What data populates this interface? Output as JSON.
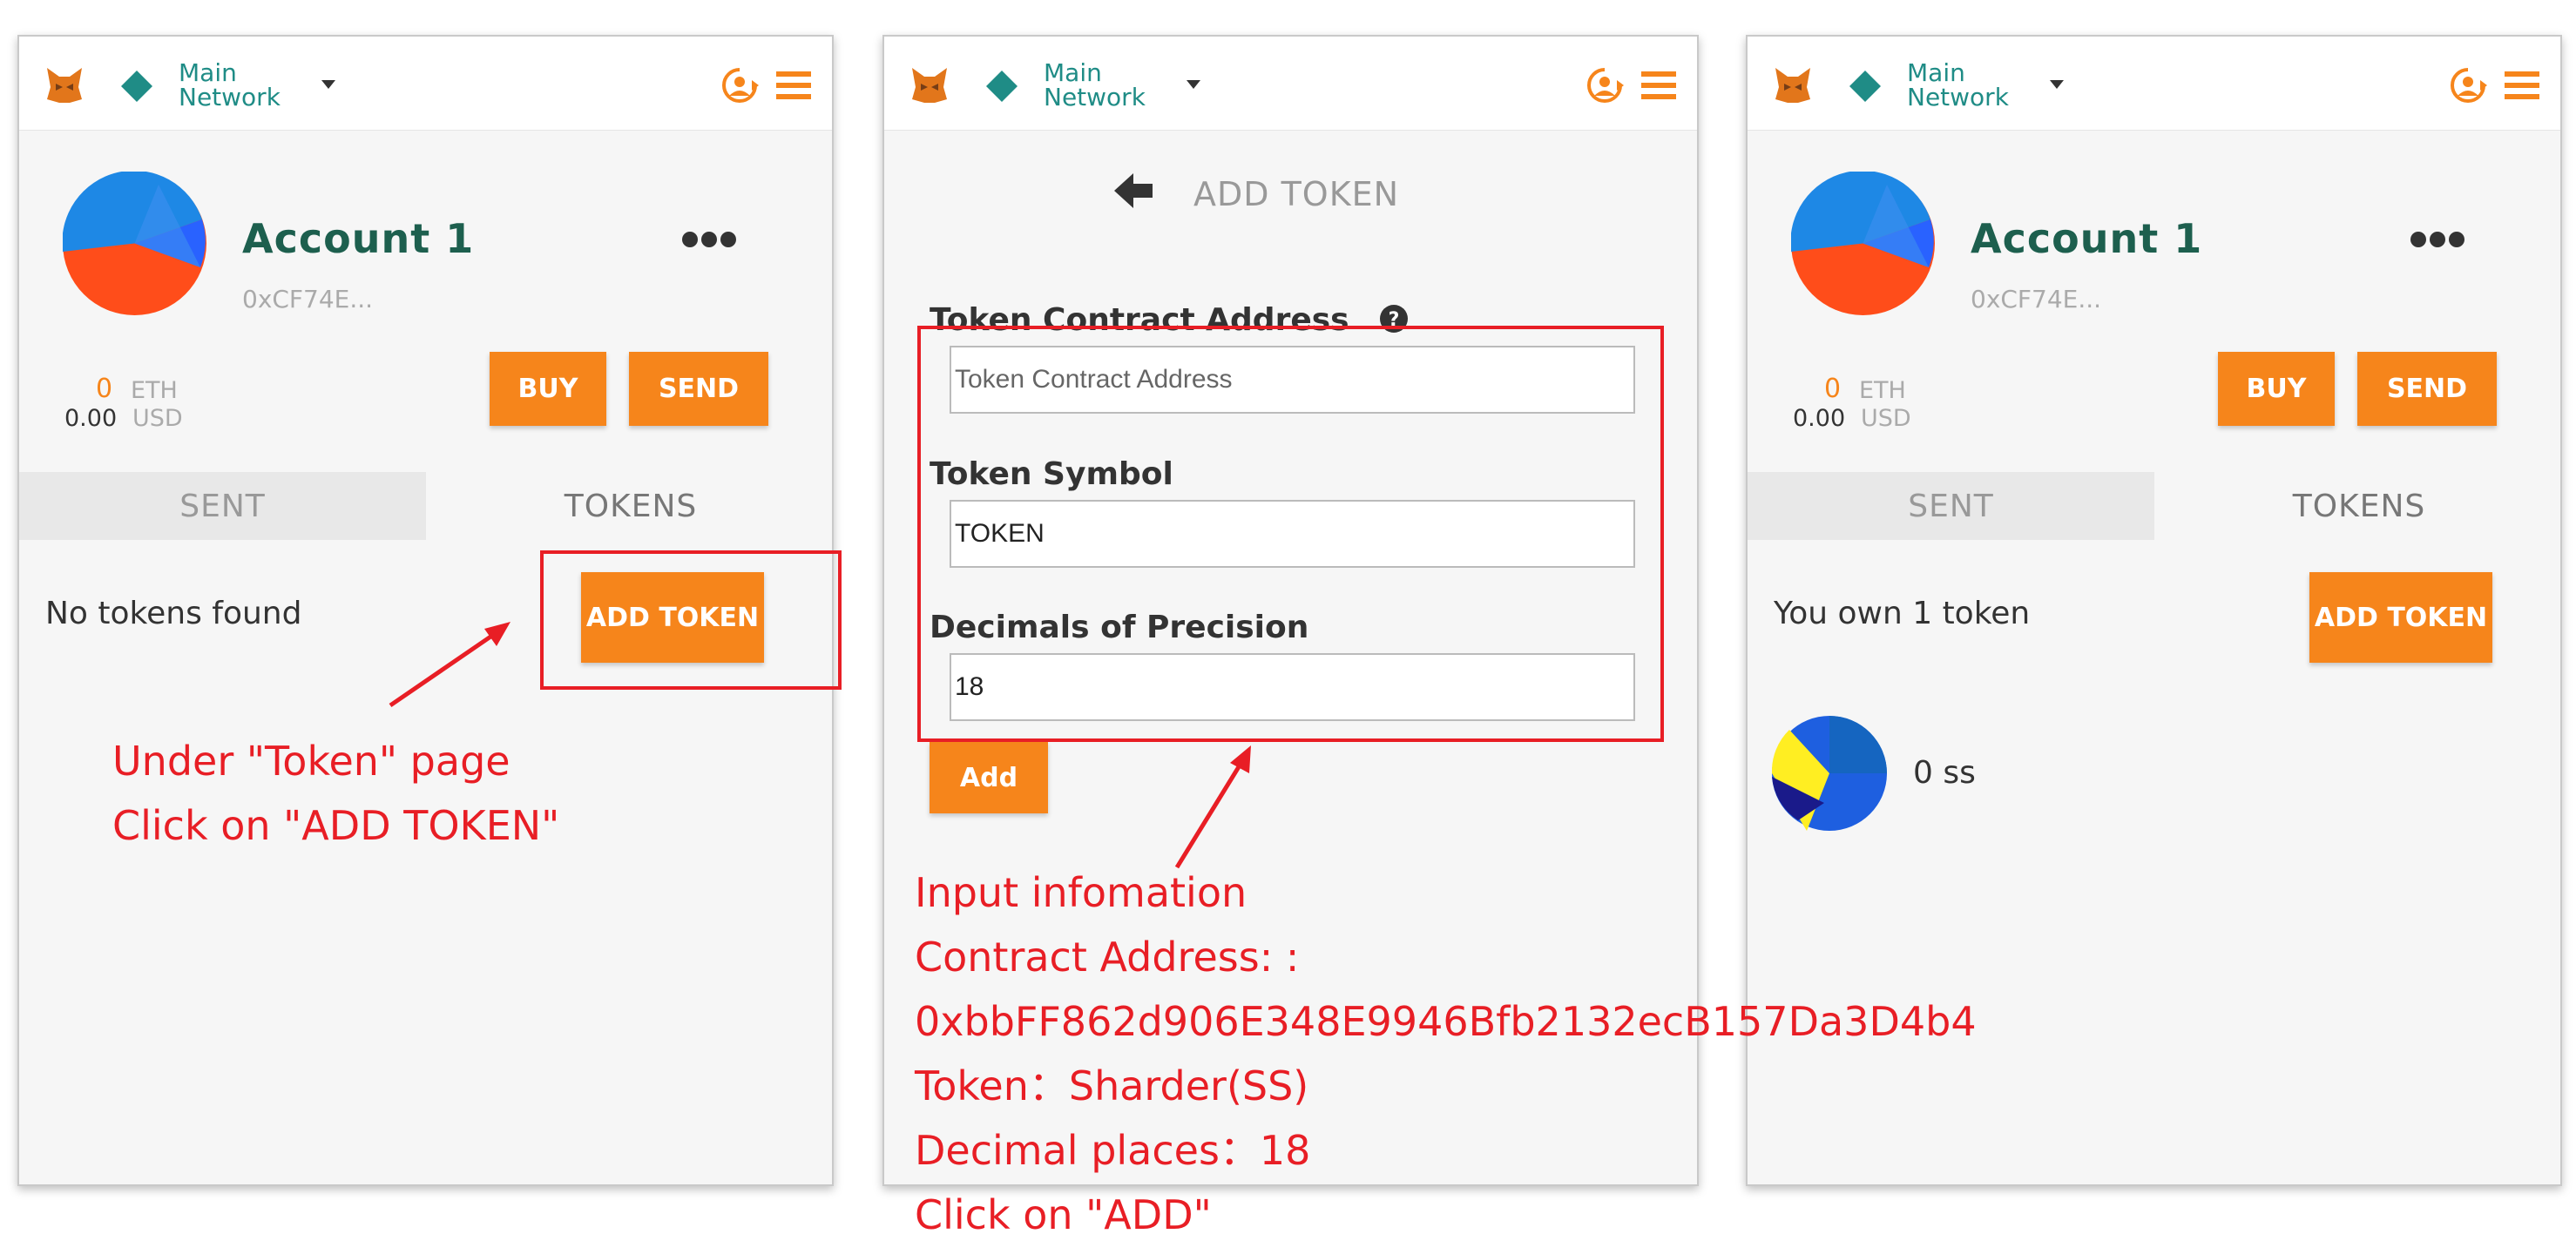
{
  "colors": {
    "accent": "#f6851b",
    "network": "#1f8c86",
    "account_name": "#1d5f4e",
    "annotation": "#e81e25"
  },
  "header": {
    "network_line1": "Main",
    "network_line2": "Network",
    "icons": [
      "fox-logo-icon",
      "diamond-network-icon",
      "chevron-down-icon",
      "account-switch-icon",
      "menu-icon"
    ]
  },
  "account": {
    "name": "Account 1",
    "address": "0xCF74E...",
    "eth_value": "0",
    "eth_unit": "ETH",
    "usd_value": "0.00",
    "usd_unit": "USD",
    "buy_label": "BUY",
    "send_label": "SEND"
  },
  "tabs": {
    "sent": "SENT",
    "tokens": "TOKENS"
  },
  "panel1": {
    "token_message": "No tokens found",
    "add_token_label": "ADD TOKEN",
    "annotation": [
      "Under \"Token\" page",
      "Click on \"ADD TOKEN\""
    ]
  },
  "panel2": {
    "title": "ADD TOKEN",
    "address_label": "Token Contract Address",
    "address_placeholder": "Token Contract Address",
    "symbol_label": "Token Symbol",
    "symbol_value": "TOKEN",
    "decimals_label": "Decimals of Precision",
    "decimals_value": "18",
    "add_label": "Add",
    "annotation": [
      "Input infomation",
      "Contract Address: :",
      "0xbbFF862d906E348E9946Bfb2132ecB157Da3D4b4",
      "Token：Sharder(SS)",
      "Decimal places：18",
      "Click on \"ADD\""
    ]
  },
  "panel3": {
    "token_message": "You own 1 token",
    "add_token_label": "ADD TOKEN",
    "token_balance": "0 ss"
  }
}
